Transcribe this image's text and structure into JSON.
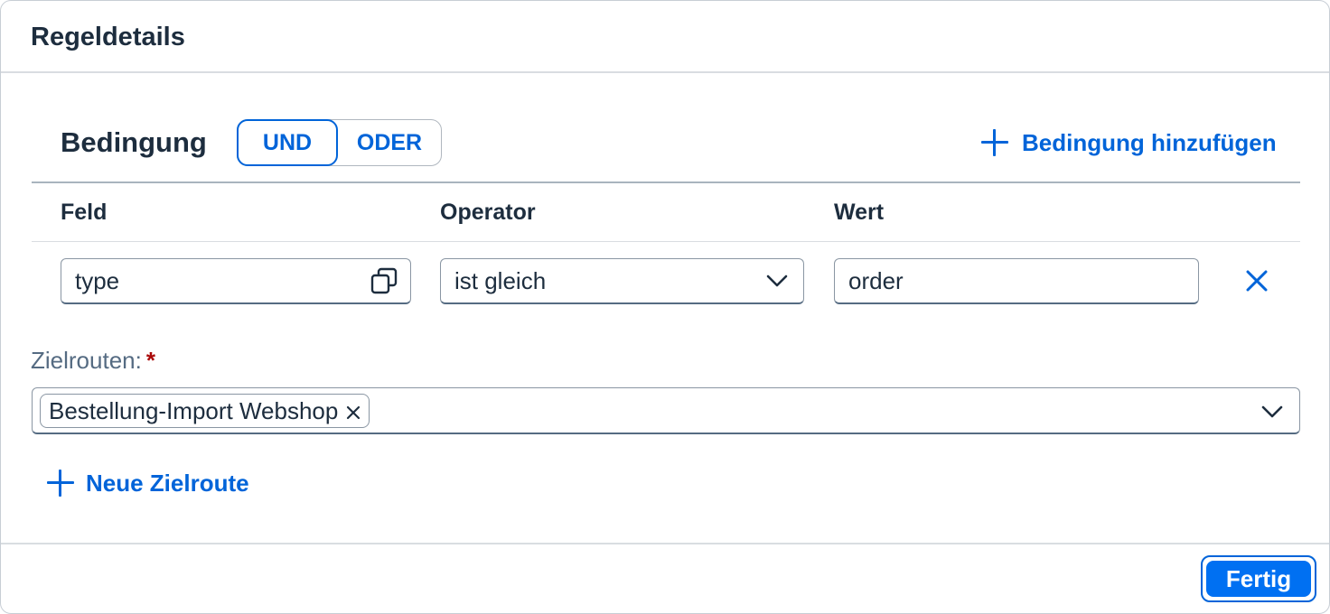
{
  "dialog": {
    "title": "Regeldetails"
  },
  "condition": {
    "title": "Bedingung",
    "segments": {
      "und": "UND",
      "oder": "ODER",
      "selected": "UND"
    },
    "add_label": "Bedingung hinzufügen",
    "columns": {
      "field": "Feld",
      "operator": "Operator",
      "value": "Wert"
    },
    "row": {
      "field_value": "type",
      "operator_value": "ist gleich",
      "value_value": "order"
    }
  },
  "target_routes": {
    "label": "Zielrouten:",
    "required_mark": "*",
    "tokens": [
      "Bestellung-Import Webshop"
    ],
    "new_label": "Neue Zielroute"
  },
  "footer": {
    "done_label": "Fertig"
  },
  "colors": {
    "accent": "#0064d9",
    "primary_button": "#0070f2",
    "required": "#aa0808",
    "text": "#1d2d3e"
  },
  "icons": {
    "field_value_help": "value-help-icon",
    "operator_dropdown": "chevron-down-icon",
    "delete_row": "close-icon",
    "token_remove": "close-icon",
    "routes_dropdown": "chevron-down-icon",
    "add": "plus-icon"
  }
}
